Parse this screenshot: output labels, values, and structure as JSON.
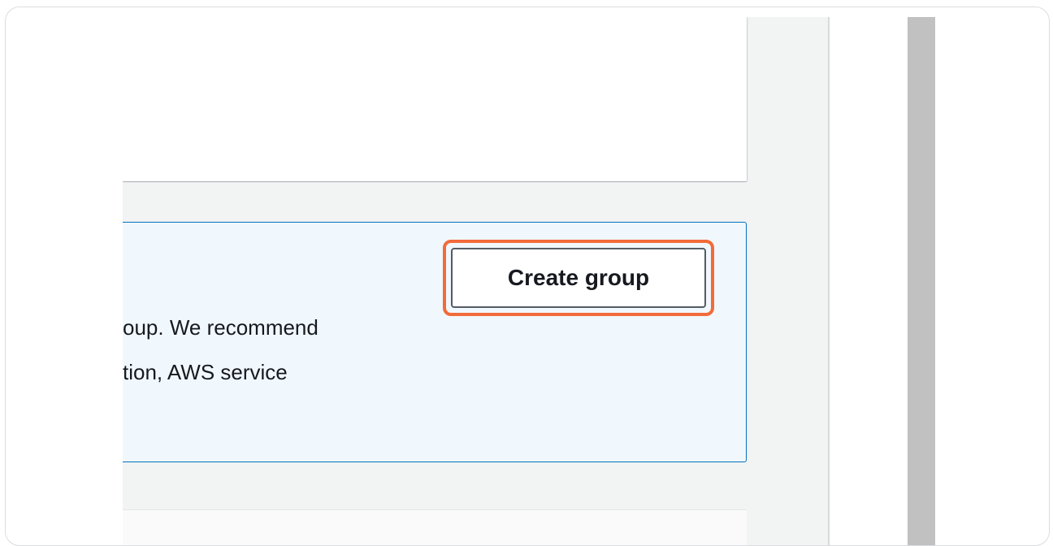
{
  "info_panel": {
    "text_lines": [
      "oup. We recommend",
      "tion, AWS service"
    ],
    "create_button_label": "Create group"
  },
  "colors": {
    "highlight": "#f26b3a",
    "panel_background": "#f1f8fd",
    "panel_border": "#0073bb",
    "page_background": "#f2f3f3"
  }
}
